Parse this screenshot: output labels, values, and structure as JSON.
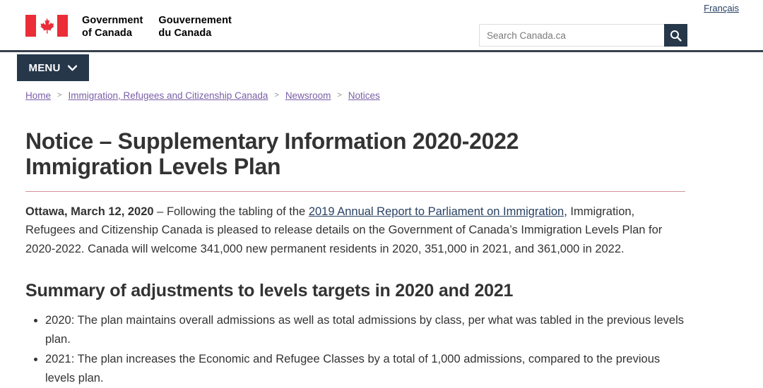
{
  "header": {
    "flag_alt": "canada-flag",
    "wordmark_en": "Government\nof Canada",
    "wordmark_fr": "Gouvernement\ndu Canada",
    "language_toggle": "Français",
    "search": {
      "placeholder": "Search Canada.ca",
      "value": "",
      "button_icon": "search-icon"
    },
    "menu": {
      "label": "MENU",
      "icon": "chevron-down-icon"
    },
    "colors": {
      "navy": "#26374A",
      "flag_red": "#EA2D37",
      "rule_red": "#AF3C43",
      "link_blue": "#284162",
      "visited_purple": "#7A5EA8"
    }
  },
  "breadcrumb": {
    "separator": ">",
    "items": [
      {
        "label": "Home"
      },
      {
        "label": "Immigration, Refugees and Citizenship Canada"
      },
      {
        "label": "Newsroom"
      },
      {
        "label": "Notices"
      }
    ]
  },
  "main": {
    "title": "Notice – Supplementary Information 2020-2022 Immigration Levels Plan",
    "lede": {
      "dateline": "Ottawa, March 12, 2020",
      "text_before_link": " – Following the tabling of the ",
      "link_text": "2019 Annual Report to Parliament on Immigration",
      "text_after_link": ", Immigration, Refugees and Citizenship Canada is pleased to release details on the Government of Canada’s Immigration Levels Plan for 2020-2022. Canada will welcome 341,000 new permanent residents in 2020, 351,000 in 2021, and 361,000 in 2022."
    },
    "section_title": "Summary of adjustments to levels targets in 2020 and 2021",
    "bullets": [
      "2020: The plan maintains overall admissions as well as total admissions by class, per what was tabled in the previous levels plan.",
      "2021: The plan increases the Economic and Refugee Classes by a total of 1,000 admissions, compared to the previous levels plan."
    ]
  }
}
